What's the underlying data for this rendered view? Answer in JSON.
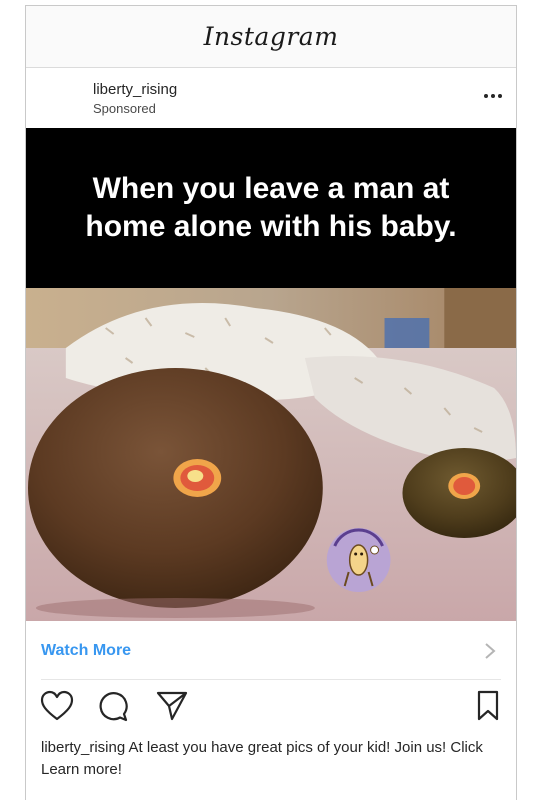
{
  "app": {
    "title": "Instagram"
  },
  "post": {
    "username": "liberty_rising",
    "sponsored_label": "Sponsored",
    "meme_text": "When you leave a man at home alone with his baby.",
    "cta_label": "Watch More",
    "caption_user": "liberty_rising",
    "caption_text": " At least you have great pics of your kid! Join us! Click Learn more!"
  },
  "icons": {
    "more": "more-dots-icon",
    "like": "heart-icon",
    "comment": "comment-icon",
    "share": "send-icon",
    "save": "bookmark-icon",
    "chevron": "chevron-right-icon"
  },
  "colors": {
    "link_blue": "#3897f0",
    "text": "#262626",
    "meme_band": "#000000"
  }
}
